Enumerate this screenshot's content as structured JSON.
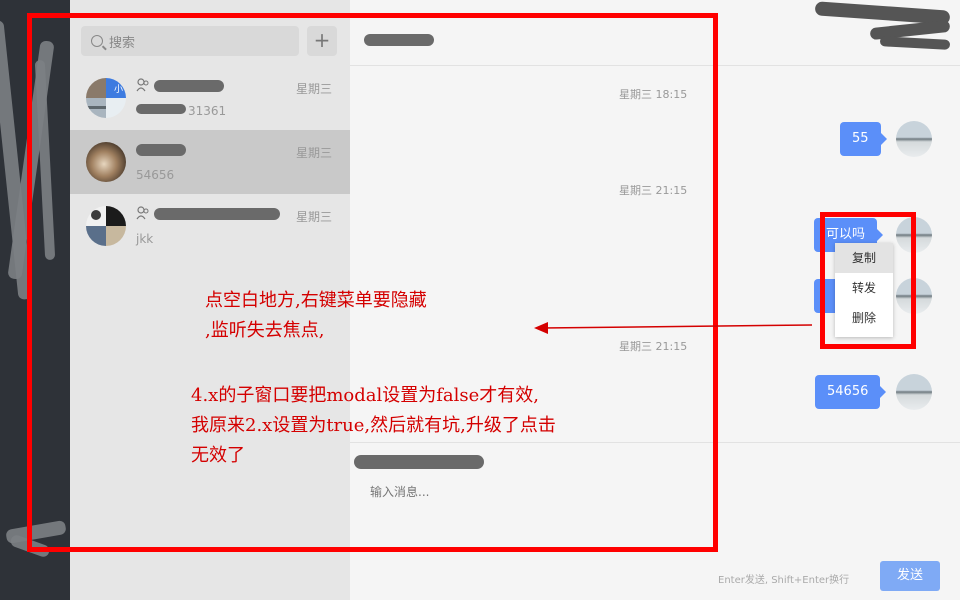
{
  "sidebar": {
    "search_placeholder": "搜索",
    "add_label": "+",
    "conversations": [
      {
        "day": "星期三",
        "preview": "31361",
        "group": true
      },
      {
        "day": "星期三",
        "preview": "54656",
        "group": false,
        "selected": true
      },
      {
        "day": "星期三",
        "preview": "jkk",
        "group": true
      }
    ]
  },
  "chat": {
    "messages": [
      {
        "time": "星期三 18:15",
        "text": "55"
      },
      {
        "time": "星期三 21:15",
        "text": "可以吗"
      },
      {
        "time": "星期三 21:15",
        "text": "54656"
      }
    ],
    "input_placeholder": "输入消息...",
    "hint": "Enter发送, Shift+Enter换行",
    "send_label": "发送"
  },
  "context_menu": {
    "items": [
      "复制",
      "转发",
      "删除"
    ]
  },
  "annotations": {
    "note1_line1": "点空白地方,右键菜单要隐藏",
    "note1_line2": ",监听失去焦点,",
    "note2_line1": "4.x的子窗口要把modal设置为false才有效,",
    "note2_line2": "我原来2.x设置为true,然后就有坑,升级了点击",
    "note2_line3": "无效了"
  },
  "colors": {
    "accent": "#5b8ff9",
    "annotation": "#ff0000",
    "rail": "#2e3238"
  }
}
